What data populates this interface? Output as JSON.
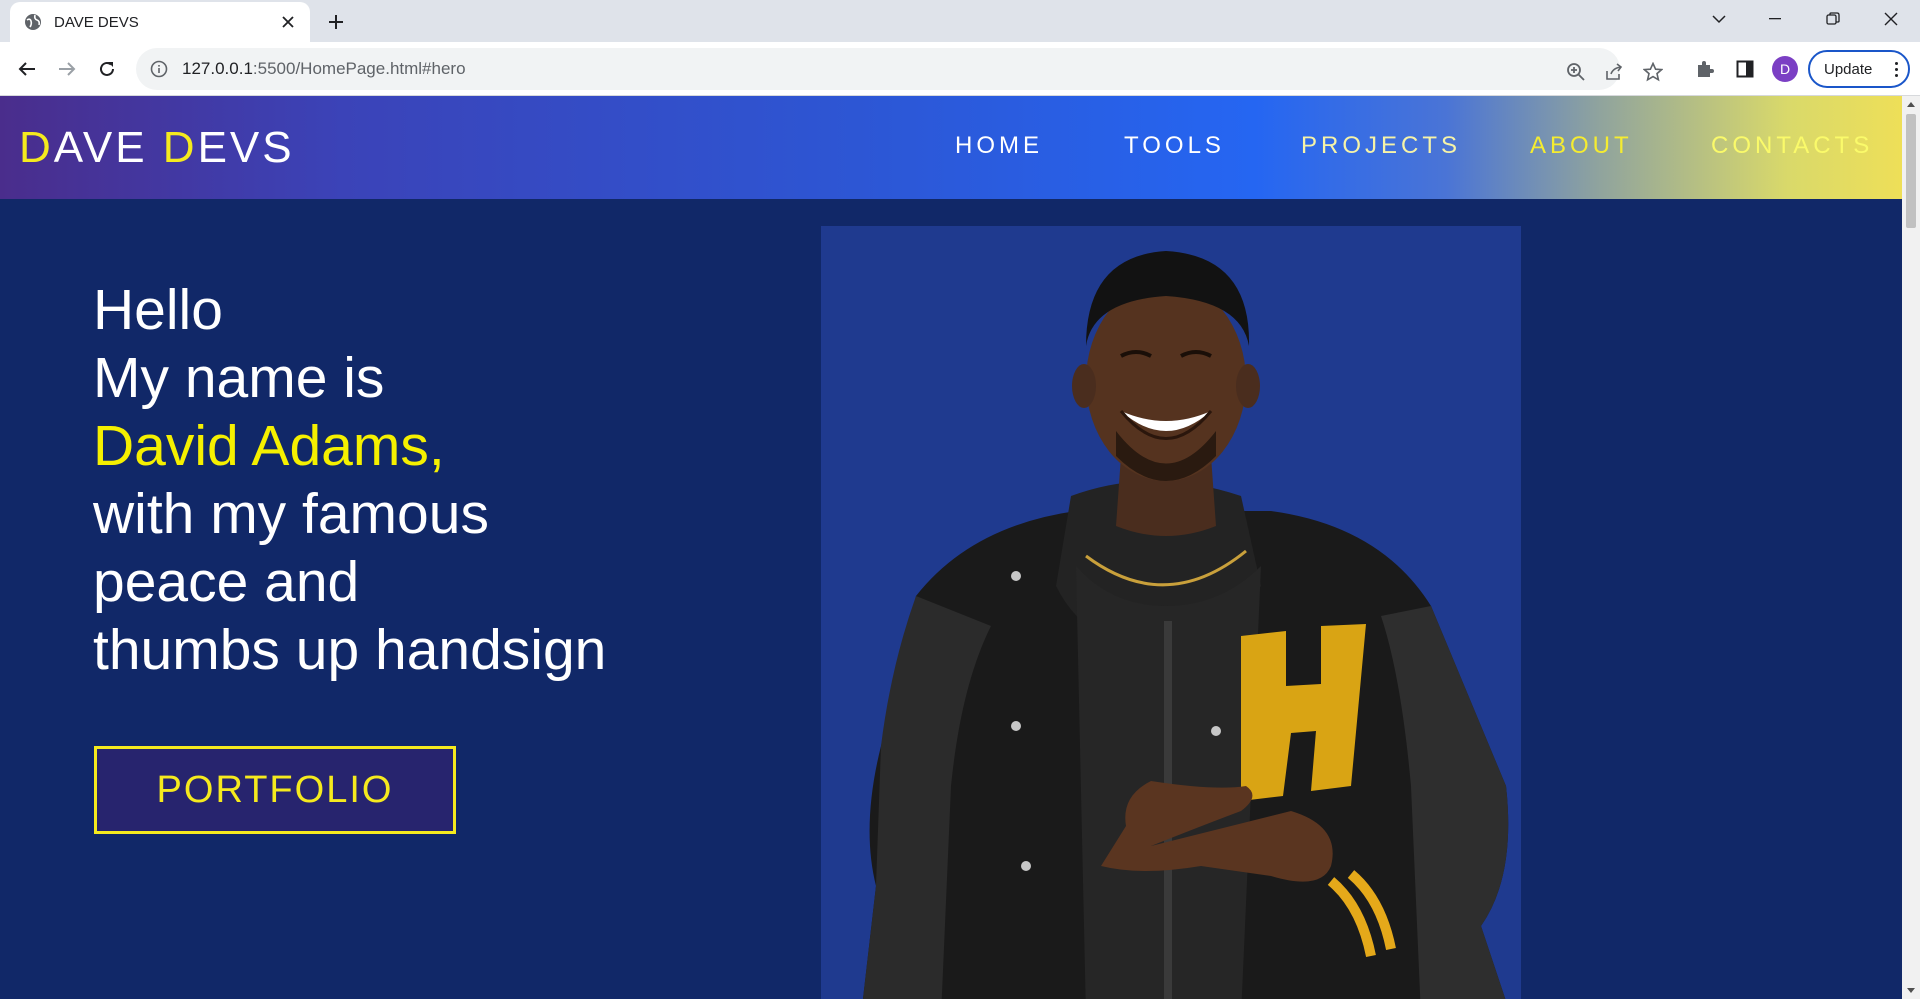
{
  "browser": {
    "tab_title": "DAVE DEVS",
    "url_host": "127.0.0.1",
    "url_rest": ":5500/HomePage.html#hero",
    "update_label": "Update",
    "avatar_letter": "D"
  },
  "site": {
    "logo": {
      "first_initial": "D",
      "first_rest": "AVE ",
      "second_initial": "D",
      "second_rest": "EVS"
    },
    "nav": [
      "HOME",
      "TOOLS",
      "PROJECTS",
      "ABOUT",
      "CONTACTS"
    ],
    "hero": {
      "line1": "Hello",
      "line2": "My name is",
      "name": "David Adams,",
      "line4": "with my famous",
      "line5": "peace and",
      "line6": "thumbs up handsign",
      "button": "PORTFOLIO"
    },
    "colors": {
      "page_background": "#112868",
      "accent_yellow": "#f5ea1e",
      "photo_panel": "#1f3a8f"
    }
  }
}
